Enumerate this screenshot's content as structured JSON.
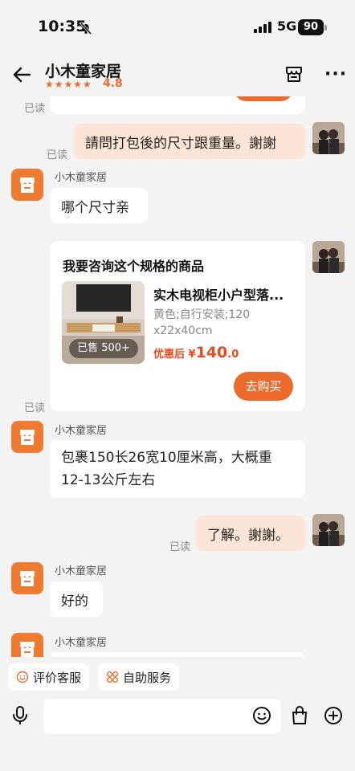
{
  "status_bar": {
    "time": "10:35",
    "network": "5G",
    "battery": "90"
  },
  "header": {
    "shop_name": "小木童家居",
    "stars": "★★★★★",
    "rating": "4.8"
  },
  "messages": {
    "read_label": "已读",
    "m1_text": "請問打包後的尺寸跟重量。謝謝",
    "shop_sender": "小木童家居",
    "m2_text": "哪个尺寸亲",
    "m3_card_title": "我要咨询这个规格的商品",
    "m3_product_name": "实木电视柜小户型落...",
    "m3_product_spec": "黄色;自行安装;120x22x40cm",
    "m3_sold": "已售 500+",
    "m3_price_prefix": "优惠后 ¥",
    "m3_price_int": "140",
    "m3_price_dec": ".0",
    "m3_buy": "去购买",
    "m4_text": "包裹150长26宽10厘米高，大概重12-13公斤左右",
    "m5_text": "了解。謝謝。",
    "m6_text": "好的"
  },
  "quick_actions": {
    "rate": "评价客服",
    "self_service": "自助服务"
  },
  "colors": {
    "accent": "#ec6a2c",
    "my_bubble": "#fbe5d6",
    "background": "#f3f3f3"
  },
  "icons": [
    "back-arrow-icon",
    "store-icon",
    "more-icon",
    "mic-icon",
    "emoji-icon",
    "bag-icon",
    "plus-icon"
  ]
}
